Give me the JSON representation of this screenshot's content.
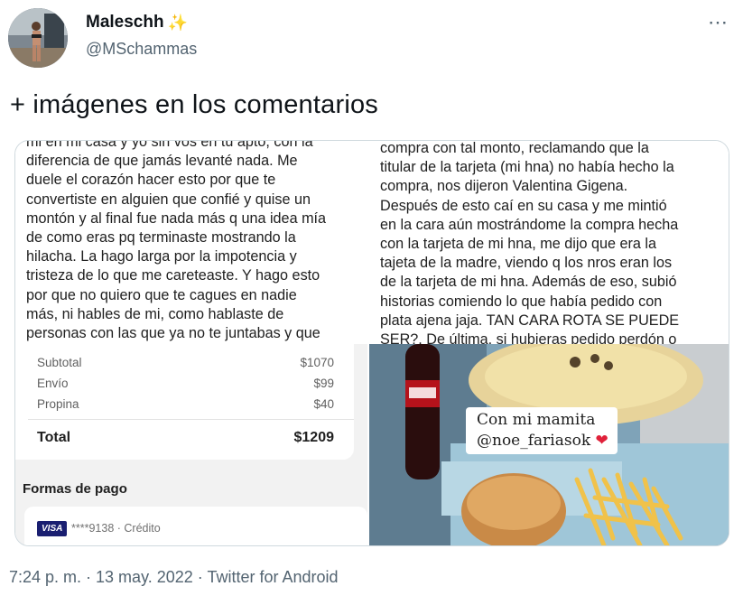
{
  "author": {
    "display_name": "Maleschh",
    "verified_emoji": "✨",
    "handle": "@MSchammas"
  },
  "more_icon": "⋯",
  "tweet": {
    "text": "+ imágenes en los comentarios"
  },
  "media": {
    "left_text": {
      "lines": [
        "mi en mi casa y yo sin vos en tu apto, con la",
        "diferencia de que jamás levanté nada. Me",
        "duele el corazón hacer esto por que te",
        "convertiste en alguien que confié y quise un",
        "montón y al final fue nada más q una idea mía",
        "de como eras pq terminaste mostrando la",
        "hilacha. La hago larga por la impotencia y",
        "tristeza de lo que me careteaste. Y hago esto",
        "por que no quiero que te cagues en nadie",
        "más, ni hables de mi, como hablaste de",
        "personas con las que ya no te juntabas y que"
      ]
    },
    "right_text": {
      "lines": [
        "compra con tal monto, reclamando que la",
        "titular de la tarjeta (mi hna) no había hecho la",
        "compra, nos dijeron Valentina Gigena.",
        "Después de esto caí en su casa y me mintió",
        "en la cara aún mostrándome la compra hecha",
        "con la tarjeta de mi hna, me dijo que era la",
        "tajeta de la madre, viendo q los nros eran los",
        "de la tarjeta de mi hna. Además de eso, subió",
        "historias comiendo lo que había pedido con",
        "plata ajena jaja. TAN CARA ROTA SE PUEDE",
        "SER?. De última, si hubieras pedido perdón o"
      ]
    },
    "receipt": {
      "rows": [
        {
          "label": "Subtotal",
          "value": "$1070"
        },
        {
          "label": "Envío",
          "value": "$99"
        },
        {
          "label": "Propina",
          "value": "$40"
        }
      ],
      "total_label": "Total",
      "total_value": "$1209",
      "payment_title": "Formas de pago",
      "card_brand": "VISA",
      "card_number": "****9138 · Crédito"
    },
    "photo": {
      "caption_line1": "Con mi mamita",
      "caption_line2": "@noe_fariasok",
      "heart": "❤"
    }
  },
  "footer": {
    "timestamp": "7:24 p. m. · 13 may. 2022 · Twitter for Android"
  }
}
